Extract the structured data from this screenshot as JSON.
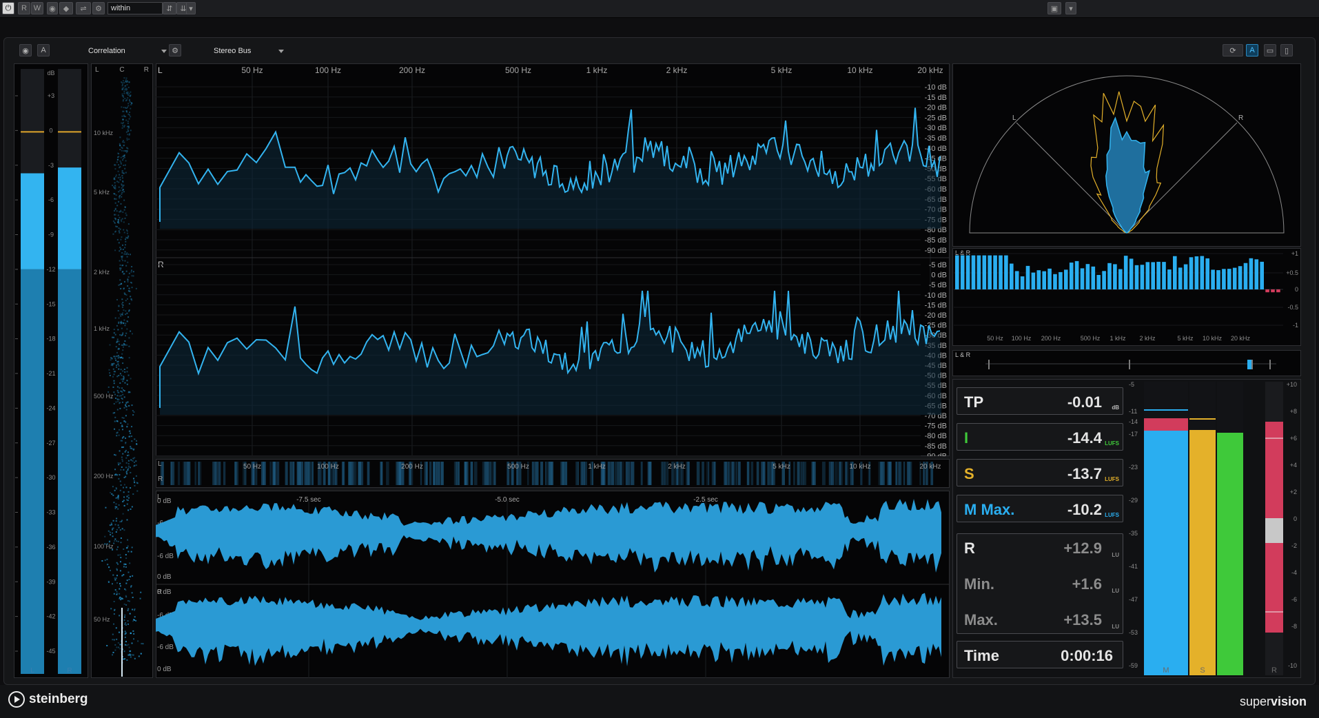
{
  "toolbar": {
    "read_label": "R",
    "write_label": "W",
    "preset_field": "within"
  },
  "header": {
    "module_selector": "Correlation",
    "bus_selector": "Stereo Bus",
    "auto_label": "A",
    "auto_label2": "A"
  },
  "level_meter": {
    "scale": [
      "dB",
      "+3",
      "0",
      "-3",
      "-6",
      "-9",
      "-12",
      "-15",
      "-18",
      "-21",
      "-24",
      "-27",
      "-30",
      "-33",
      "-36",
      "-39",
      "-42",
      "-45"
    ],
    "channels": [
      "L",
      "R"
    ],
    "left_level_db": -3.7,
    "right_level_db": -3.2
  },
  "spectrogram": {
    "top_labels": [
      "L",
      "C",
      "R"
    ],
    "freq_labels": [
      "10 kHz",
      "5 kHz",
      "2 kHz",
      "1 kHz",
      "500 Hz",
      "200 Hz",
      "100 Hz",
      "50 Hz"
    ]
  },
  "spectrum": {
    "freq_labels": [
      "50 Hz",
      "100 Hz",
      "200 Hz",
      "500 Hz",
      "1 kHz",
      "2 kHz",
      "5 kHz",
      "10 kHz",
      "20 kHz"
    ],
    "channel_l": "L",
    "channel_r": "R",
    "db_labels_l": [
      "-10 dB",
      "-15 dB",
      "-20 dB",
      "-25 dB",
      "-30 dB",
      "-35 dB",
      "-40 dB",
      "-45 dB",
      "-50 dB",
      "-55 dB",
      "-60 dB",
      "-65 dB",
      "-70 dB",
      "-75 dB",
      "-80 dB",
      "-85 dB",
      "-90 dB"
    ],
    "db_labels_r": [
      "-5 dB",
      "0 dB",
      "-5 dB",
      "-10 dB",
      "-15 dB",
      "-20 dB",
      "-25 dB",
      "-30 dB",
      "-35 dB",
      "-40 dB",
      "-45 dB",
      "-50 dB",
      "-55 dB",
      "-60 dB",
      "-65 dB",
      "-70 dB",
      "-75 dB",
      "-80 dB",
      "-85 dB",
      "-90 dB"
    ]
  },
  "strip": {
    "freq_labels": [
      "50 Hz",
      "100 Hz",
      "200 Hz",
      "500 Hz",
      "1 kHz",
      "2 kHz",
      "5 kHz",
      "10 kHz",
      "20 kHz"
    ],
    "channel_l": "L",
    "channel_r": "R"
  },
  "oscilloscope": {
    "time_labels": [
      "-7.5 sec",
      "-5.0 sec",
      "-2.5 sec"
    ],
    "db_labels_l": [
      "0 dB",
      "-6 dB",
      "-6 dB",
      "0 dB"
    ],
    "db_labels_r": [
      "0 dB",
      "-6 dB",
      "-6 dB",
      "0 dB"
    ],
    "channel_l": "L",
    "channel_r": "R"
  },
  "phasescope": {
    "label_l": "L",
    "label_r": "R"
  },
  "correlation": {
    "title": "L & R",
    "scale": [
      "+1",
      "+0.5",
      "0",
      "-0.5",
      "-1"
    ],
    "freq_labels": [
      "50 Hz",
      "100 Hz",
      "200 Hz",
      "500 Hz",
      "1 kHz",
      "2 kHz",
      "5 kHz",
      "10 kHz",
      "20 kHz"
    ]
  },
  "balance": {
    "title": "L & R"
  },
  "loudness": {
    "tp": {
      "name": "TP",
      "value": "-0.01",
      "unit": "dB"
    },
    "i": {
      "name": "I",
      "value": "-14.4",
      "unit": "LUFS"
    },
    "s": {
      "name": "S",
      "value": "-13.7",
      "unit": "LUFS"
    },
    "m_max": {
      "name": "M Max.",
      "value": "-10.2",
      "unit": "LUFS"
    },
    "r": {
      "name": "R",
      "value": "+12.9",
      "unit": "LU"
    },
    "min": {
      "name": "Min.",
      "value": "+1.6",
      "unit": "LU"
    },
    "max": {
      "name": "Max.",
      "value": "+13.5",
      "unit": "LU"
    },
    "time": {
      "name": "Time",
      "value": "0:00:16"
    }
  },
  "loudness_meter": {
    "left_scale": [
      "-5",
      "-11",
      "-14",
      "-17",
      "-23",
      "-29",
      "-35",
      "-41",
      "-47",
      "-53",
      "-59"
    ],
    "right_scale": [
      "-5",
      "-11",
      "-14",
      "-17",
      "-23",
      "-29",
      "-35",
      "-41",
      "-47",
      "-53",
      "-59"
    ],
    "r_scale": [
      "+10",
      "+8",
      "+6",
      "+4",
      "+2",
      "0",
      "-2",
      "-4",
      "-6",
      "-8",
      "-10"
    ],
    "bar_labels": [
      "M",
      "S",
      "R"
    ],
    "colors": {
      "m": "#2aaef0",
      "s": "#e4b12a",
      "i": "#3fc93a",
      "r": "#d23c5c",
      "tp": "#d23c5c"
    }
  },
  "footer": {
    "logo_text": "steinberg",
    "brand_super": "super",
    "brand_vision": "vision"
  }
}
